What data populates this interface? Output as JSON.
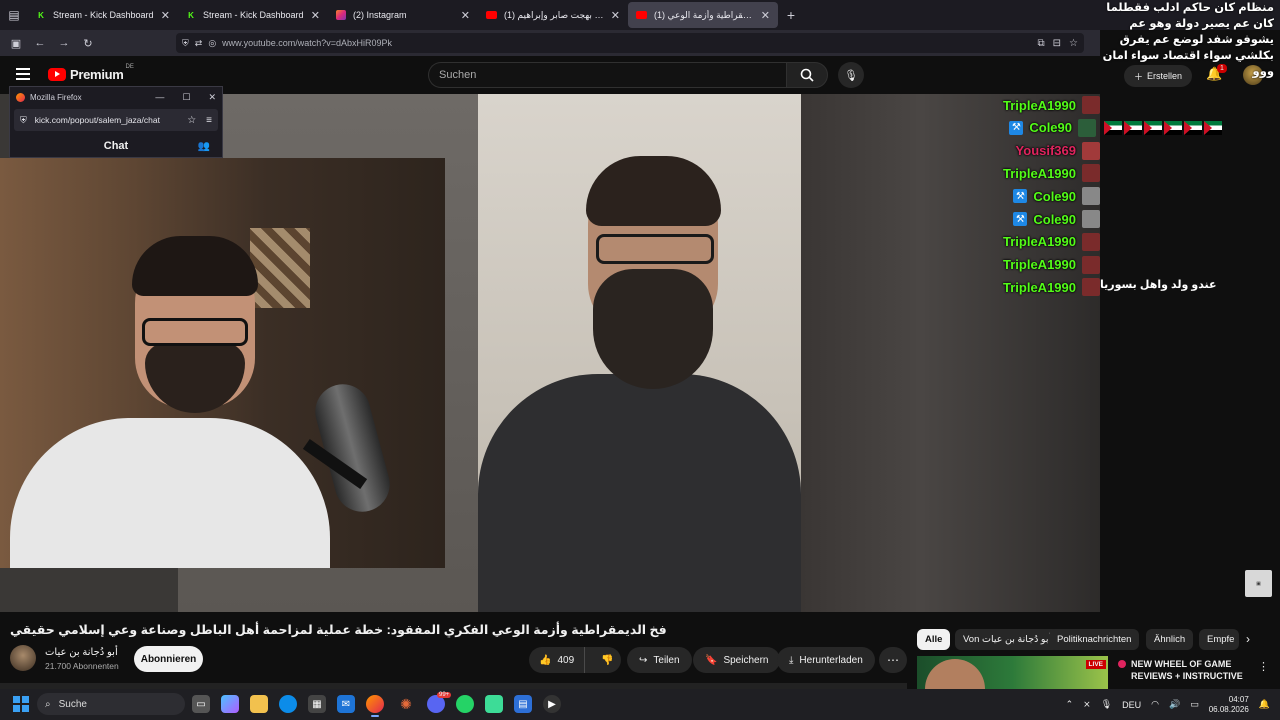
{
  "browser": {
    "tabs": [
      {
        "title": "Stream - Kick Dashboard",
        "icon": "kick-icon",
        "active": false
      },
      {
        "title": "Stream - Kick Dashboard",
        "icon": "kick-icon",
        "active": false
      },
      {
        "title": "(2) Instagram",
        "icon": "instagram-icon",
        "active": false
      },
      {
        "title": "(1) مداخلة بهجت صابر وإبراهيم ...",
        "icon": "youtube-icon",
        "active": false
      },
      {
        "title": "(1) فخ الديمقراطية وأزمة الوعي ...",
        "icon": "youtube-icon",
        "active": true
      }
    ],
    "url": "www.youtube.com/watch?v=dAbxHiR09Pk"
  },
  "youtube": {
    "logo_text": "Premium",
    "region": "DE",
    "search_placeholder": "Suchen",
    "create_label": "Erstellen",
    "notification_count": "1"
  },
  "popout": {
    "window_title": "Mozilla Firefox",
    "url": "kick.com/popout/salem_jaza/chat",
    "header": "Chat"
  },
  "overlay": {
    "top_arabic": "منظام كان حاكم ادلب فقطلما كان عم يصير دولة وهو عم يشوفو شفد لوضع عم يفرق بكلشي سواء اقتصاد سواء امان ووو",
    "chat": [
      {
        "user": "TripleA1990",
        "color": "#53fc18",
        "badge": false,
        "flags": 0
      },
      {
        "user": "Cole90",
        "color": "#53fc18",
        "badge": true,
        "flags": 6
      },
      {
        "user": "Yousif369",
        "color": "#e0245e",
        "badge": false,
        "flags": 0
      },
      {
        "user": "TripleA1990",
        "color": "#53fc18",
        "badge": false,
        "flags": 0
      },
      {
        "user": "Cole90",
        "color": "#53fc18",
        "badge": true,
        "flags": 0
      },
      {
        "user": "Cole90",
        "color": "#53fc18",
        "badge": true,
        "flags": 0
      },
      {
        "user": "TripleA1990",
        "color": "#53fc18",
        "badge": false,
        "flags": 0
      },
      {
        "user": "TripleA1990",
        "color": "#53fc18",
        "badge": false,
        "flags": 0
      },
      {
        "user": "TripleA1990",
        "color": "#53fc18",
        "badge": false,
        "flags": 0
      }
    ],
    "side_message": "عندو ولد واهل بسوريا"
  },
  "video": {
    "title": "فخ الديمقراطية وأزمة الوعي الفكري المفقود: خطة عملية لمزاحمة أهل الباطل وصناعة وعي إسلامي حقيقي",
    "channel": "أبو دُجانة بن عيات",
    "subscribers": "21.700 Abonnenten",
    "subscribe_label": "Abonnieren",
    "likes": "409",
    "share_label": "Teilen",
    "save_label": "Speichern",
    "download_label": "Herunterladen"
  },
  "sidebar": {
    "chips": [
      "Alle",
      "Von أبو دُجانة بن عيات",
      "Politiknachrichten",
      "Ähnlich",
      "Empfe"
    ],
    "recommended": {
      "live_label": "LIVE",
      "title": "NEW WHEEL OF GAME REVIEWS + INSTRUCTIVE ..."
    }
  },
  "taskbar": {
    "search_label": "Suche",
    "language": "DEU",
    "time": "04:07",
    "date": "06.08.2026",
    "discord_badge": "99+"
  }
}
